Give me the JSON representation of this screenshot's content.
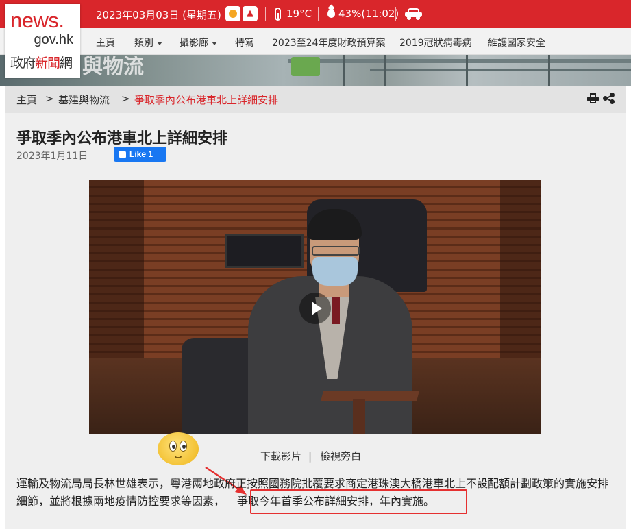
{
  "logo": {
    "line1": "news.",
    "line2": "gov.hk",
    "line3_pre": "政府",
    "line3_red": "新聞",
    "line3_post": "網"
  },
  "topbar": {
    "date": "2023年03月03日 (星期五)",
    "temperature": "19°C",
    "humidity": "43%(11:02)",
    "icons": [
      "sunny-icon",
      "fire-danger-icon",
      "thermometer-icon",
      "humidity-icon",
      "traffic-car-icon"
    ]
  },
  "nav": {
    "items": [
      {
        "label": "主頁",
        "dropdown": false
      },
      {
        "label": "類別",
        "dropdown": true
      },
      {
        "label": "攝影廊",
        "dropdown": true
      },
      {
        "label": "特寫",
        "dropdown": false
      },
      {
        "label": "2023至24年度財政預算案",
        "dropdown": false
      },
      {
        "label": "2019冠狀病毒病",
        "dropdown": false
      },
      {
        "label": "維護國家安全",
        "dropdown": false
      }
    ]
  },
  "hero": {
    "text": "與物流"
  },
  "breadcrumb": {
    "home": "主頁",
    "sep": ">",
    "category": "基建與物流",
    "current": "爭取季內公布港車北上詳細安排"
  },
  "article": {
    "title": "爭取季內公布港車北上詳細安排",
    "date": "2023年1月11日",
    "fb_like": "Like 1",
    "video_links": {
      "download": "下載影片",
      "pipe": "|",
      "transcript": "檢視旁白"
    },
    "paragraph_start": "運輸及物流局局長林世雄表示，粵港兩地政府正按照國務院批覆要求商定港珠澳大橋港車北上不設配額計劃政策的實施安排細節，並將根據兩地疫情防控要求等因素，",
    "paragraph_highlight": "爭取今年首季公布詳細安排，年內實施。"
  },
  "colors": {
    "brand_red": "#d9262b",
    "annotation_red": "#e53030",
    "fb_blue": "#1877f2"
  }
}
